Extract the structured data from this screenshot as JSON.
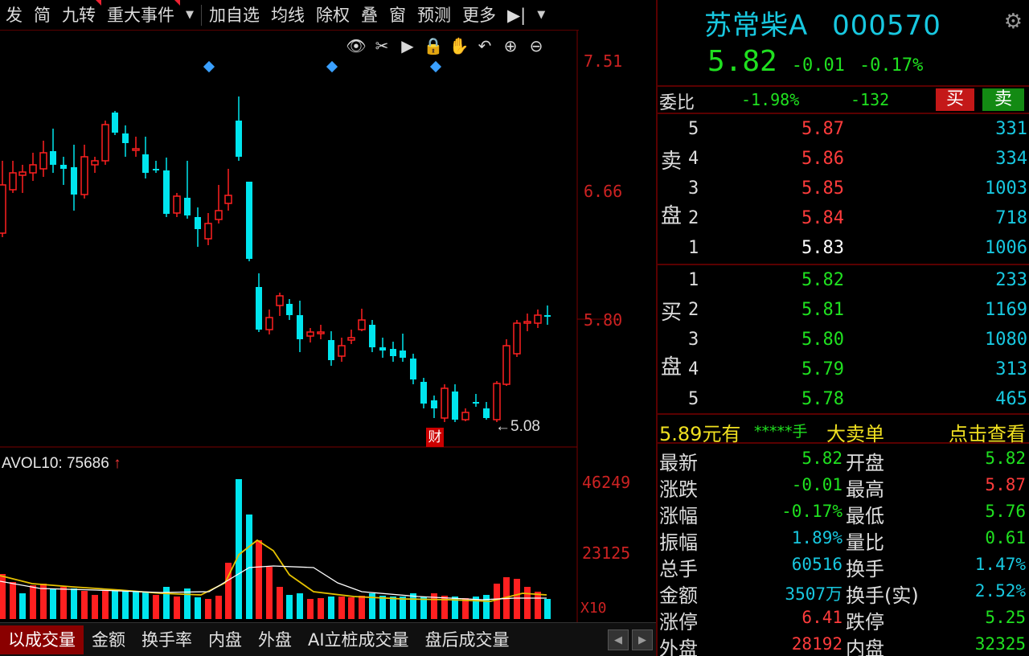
{
  "toolbar": {
    "items": [
      "发",
      "简",
      "九转",
      "重大事件",
      "▼",
      "加自选",
      "均线",
      "除权",
      "叠",
      "窗",
      "预测",
      "更多",
      "▶|",
      "▼"
    ]
  },
  "chart": {
    "price_ticks": [
      "7.51",
      "6.66",
      "5.80"
    ],
    "vol_ticks": [
      "46249",
      "23125"
    ],
    "vol_unit": "X10",
    "vol_indicator": "AVOL10: 75686",
    "vol_arrow": "↑",
    "low_marker": "←5.08",
    "event_badge": "财",
    "up_color": "#ff2020",
    "down_color": "#00e5ee"
  },
  "bottom_tabs": [
    "以成交量",
    "金额",
    "换手率",
    "内盘",
    "外盘",
    "AI立桩成交量",
    "盘后成交量"
  ],
  "quote": {
    "name": "苏常柴A",
    "code": "000570",
    "price": "5.82",
    "change": "-0.01",
    "change_pct": "-0.17%",
    "webi_label": "委比",
    "webi_pct": "-1.98%",
    "webi_diff": "-132",
    "buy_label": "买",
    "sell_label": "卖"
  },
  "orderbook": {
    "ask_side": [
      "卖",
      "盘"
    ],
    "bid_side": [
      "买",
      "盘"
    ],
    "asks": [
      {
        "level": "5",
        "price": "5.87",
        "qty": "331"
      },
      {
        "level": "4",
        "price": "5.86",
        "qty": "334"
      },
      {
        "level": "3",
        "price": "5.85",
        "qty": "1003"
      },
      {
        "level": "2",
        "price": "5.84",
        "qty": "718"
      },
      {
        "level": "1",
        "price": "5.83",
        "qty": "1006"
      }
    ],
    "bids": [
      {
        "level": "1",
        "price": "5.82",
        "qty": "233"
      },
      {
        "level": "2",
        "price": "5.81",
        "qty": "1169"
      },
      {
        "level": "3",
        "price": "5.80",
        "qty": "1080"
      },
      {
        "level": "4",
        "price": "5.79",
        "qty": "313"
      },
      {
        "level": "5",
        "price": "5.78",
        "qty": "465"
      }
    ]
  },
  "big_order": {
    "price_text": "5.89元有",
    "qty_text": "*****手",
    "label": "大卖单",
    "link": "点击查看"
  },
  "stats": [
    {
      "k1": "最新",
      "v1": "5.82",
      "c1": "green",
      "k2": "开盘",
      "v2": "5.82",
      "c2": "green"
    },
    {
      "k1": "涨跌",
      "v1": "-0.01",
      "c1": "green",
      "k2": "最高",
      "v2": "5.87",
      "c2": "red"
    },
    {
      "k1": "涨幅",
      "v1": "-0.17%",
      "c1": "green",
      "k2": "最低",
      "v2": "5.76",
      "c2": "green"
    },
    {
      "k1": "振幅",
      "v1": "1.89%",
      "c1": "cyan",
      "k2": "量比",
      "v2": "0.61",
      "c2": "green"
    },
    {
      "k1": "总手",
      "v1": "60516",
      "c1": "cyan",
      "k2": "换手",
      "v2": "1.47%",
      "c2": "cyan"
    },
    {
      "k1": "金额",
      "v1": "3507万",
      "c1": "cyan",
      "k2": "换手(实)",
      "v2": "2.52%",
      "c2": "cyan"
    },
    {
      "k1": "涨停",
      "v1": "6.41",
      "c1": "red",
      "k2": "跌停",
      "v2": "5.25",
      "c2": "green"
    },
    {
      "k1": "外盘",
      "v1": "28192",
      "c1": "red",
      "k2": "内盘",
      "v2": "32325",
      "c2": "green"
    }
  ]
}
